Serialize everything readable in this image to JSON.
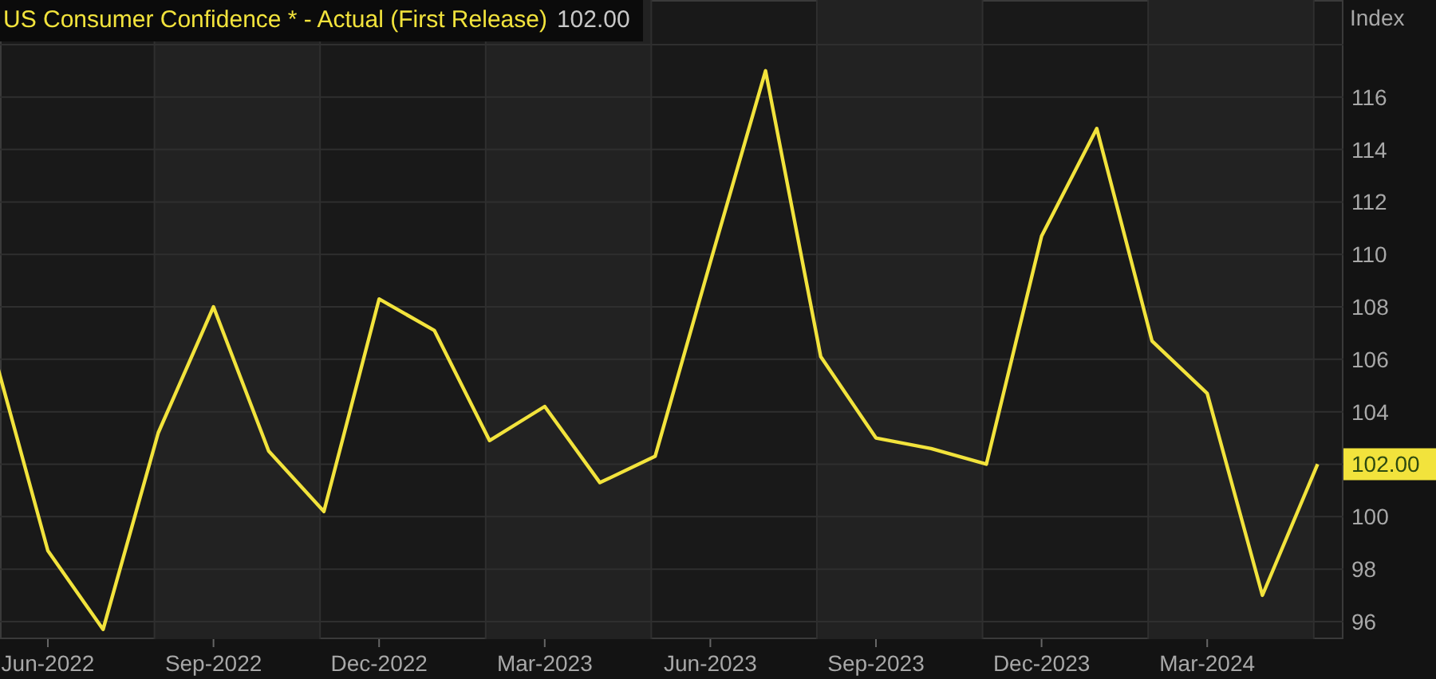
{
  "legend": {
    "value": "102.00"
  },
  "current_value_tag": "102.00",
  "chart_data": {
    "type": "line",
    "ylabel": "Index",
    "categories": [
      null,
      "Jun-2022",
      null,
      null,
      "Sep-2022",
      null,
      null,
      "Dec-2022",
      null,
      null,
      "Mar-2023",
      null,
      null,
      "Jun-2023",
      null,
      null,
      "Sep-2023",
      null,
      null,
      "Dec-2023",
      null,
      null,
      "Mar-2024",
      null,
      null
    ],
    "series": [
      {
        "name": "US Consumer Confidence * - Actual (First Release)",
        "color": "#f2e33c",
        "values": [
          106.4,
          98.7,
          95.7,
          103.2,
          108.0,
          102.5,
          100.2,
          108.3,
          107.1,
          102.9,
          104.2,
          101.3,
          102.3,
          109.7,
          117.0,
          106.1,
          103.0,
          102.6,
          102.0,
          110.7,
          114.8,
          106.7,
          104.7,
          97.0,
          102.0
        ]
      }
    ],
    "ylim": [
      95.33,
      119.7
    ],
    "grid": true,
    "yticks": [
      96,
      98,
      100,
      104,
      106,
      108,
      110,
      112,
      114,
      116
    ]
  }
}
